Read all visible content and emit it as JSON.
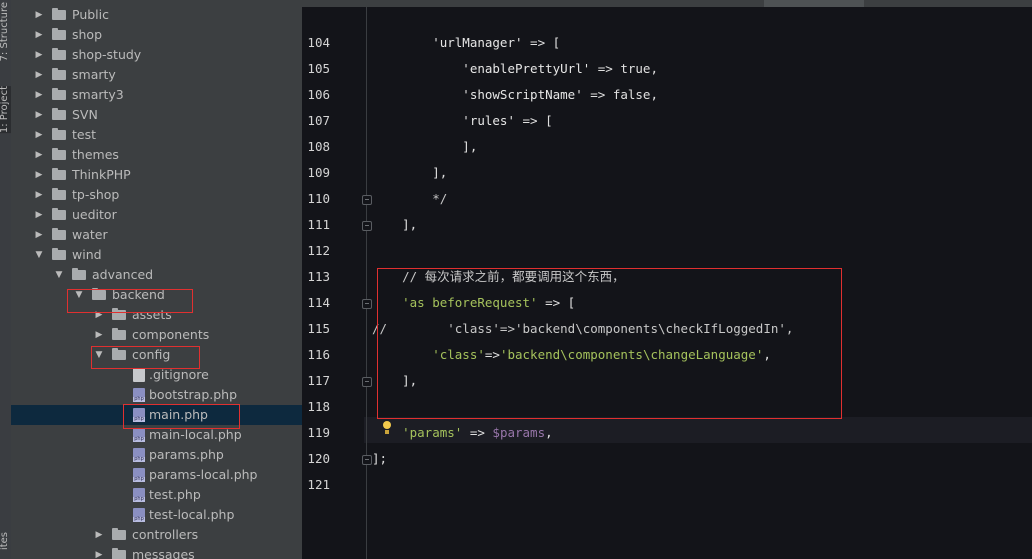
{
  "side_tabs": {
    "structure": "7: Structure",
    "project": "1: Project",
    "bottom": "ites"
  },
  "tree": [
    {
      "label": "Public",
      "indent": 0,
      "kind": "folder",
      "expanded": false
    },
    {
      "label": "shop",
      "indent": 0,
      "kind": "folder",
      "expanded": false
    },
    {
      "label": "shop-study",
      "indent": 0,
      "kind": "folder",
      "expanded": false
    },
    {
      "label": "smarty",
      "indent": 0,
      "kind": "folder",
      "expanded": false
    },
    {
      "label": "smarty3",
      "indent": 0,
      "kind": "folder",
      "expanded": false
    },
    {
      "label": "SVN",
      "indent": 0,
      "kind": "folder",
      "expanded": false
    },
    {
      "label": "test",
      "indent": 0,
      "kind": "folder",
      "expanded": false
    },
    {
      "label": "themes",
      "indent": 0,
      "kind": "folder",
      "expanded": false
    },
    {
      "label": "ThinkPHP",
      "indent": 0,
      "kind": "folder",
      "expanded": false
    },
    {
      "label": "tp-shop",
      "indent": 0,
      "kind": "folder",
      "expanded": false
    },
    {
      "label": "ueditor",
      "indent": 0,
      "kind": "folder",
      "expanded": false
    },
    {
      "label": "water",
      "indent": 0,
      "kind": "folder",
      "expanded": false
    },
    {
      "label": "wind",
      "indent": 0,
      "kind": "folder",
      "expanded": true
    },
    {
      "label": "advanced",
      "indent": 1,
      "kind": "folder",
      "expanded": true
    },
    {
      "label": "backend",
      "indent": 2,
      "kind": "folder",
      "expanded": true
    },
    {
      "label": "assets",
      "indent": 3,
      "kind": "folder",
      "expanded": false
    },
    {
      "label": "components",
      "indent": 3,
      "kind": "folder",
      "expanded": false
    },
    {
      "label": "config",
      "indent": 3,
      "kind": "folder",
      "expanded": true
    },
    {
      "label": ".gitignore",
      "indent": 4,
      "kind": "git"
    },
    {
      "label": "bootstrap.php",
      "indent": 4,
      "kind": "php"
    },
    {
      "label": "main.php",
      "indent": 4,
      "kind": "php",
      "selected": true
    },
    {
      "label": "main-local.php",
      "indent": 4,
      "kind": "php"
    },
    {
      "label": "params.php",
      "indent": 4,
      "kind": "php"
    },
    {
      "label": "params-local.php",
      "indent": 4,
      "kind": "php"
    },
    {
      "label": "test.php",
      "indent": 4,
      "kind": "php"
    },
    {
      "label": "test-local.php",
      "indent": 4,
      "kind": "php"
    },
    {
      "label": "controllers",
      "indent": 3,
      "kind": "folder",
      "expanded": false
    },
    {
      "label": "messages",
      "indent": 3,
      "kind": "folder",
      "expanded": false
    }
  ],
  "code_lines": [
    {
      "n": "104",
      "segs": [
        [
          "str",
          "        'urlManager'"
        ],
        [
          "op",
          " => ["
        ]
      ]
    },
    {
      "n": "105",
      "segs": [
        [
          "str",
          "            'enablePrettyUrl'"
        ],
        [
          "op",
          " => true,"
        ]
      ]
    },
    {
      "n": "106",
      "segs": [
        [
          "str",
          "            'showScriptName'"
        ],
        [
          "op",
          " => false,"
        ]
      ]
    },
    {
      "n": "107",
      "segs": [
        [
          "str",
          "            'rules'"
        ],
        [
          "op",
          " => ["
        ]
      ]
    },
    {
      "n": "108",
      "segs": [
        [
          "op",
          "            ],"
        ]
      ]
    },
    {
      "n": "109",
      "segs": [
        [
          "op",
          "        ],"
        ]
      ]
    },
    {
      "n": "110",
      "segs": [
        [
          "cmt",
          "        */"
        ]
      ]
    },
    {
      "n": "111",
      "segs": [
        [
          "op",
          "    ],"
        ]
      ]
    },
    {
      "n": "112",
      "segs": []
    },
    {
      "n": "113",
      "segs": [
        [
          "cmt",
          "    // 每次请求之前，都要调用这个东西，"
        ]
      ]
    },
    {
      "n": "114",
      "segs": [
        [
          "grn",
          "    'as beforeRequest'"
        ],
        [
          "op",
          " => ["
        ]
      ]
    },
    {
      "n": "115",
      "segs": [
        [
          "cmt",
          "//        'class'=>'backend\\components\\checkIfLoggedIn',"
        ]
      ]
    },
    {
      "n": "116",
      "segs": [
        [
          "grn",
          "        'class'"
        ],
        [
          "op",
          "=>"
        ],
        [
          "grn",
          "'backend\\components\\changeLanguage'"
        ],
        [
          "op",
          ","
        ]
      ]
    },
    {
      "n": "117",
      "segs": [
        [
          "op",
          "    ],"
        ]
      ]
    },
    {
      "n": "118",
      "segs": []
    },
    {
      "n": "119",
      "segs": [
        [
          "grn",
          "    'params'"
        ],
        [
          "op",
          " => "
        ],
        [
          "var",
          "$params"
        ],
        [
          "op",
          ","
        ]
      ]
    },
    {
      "n": "120",
      "segs": [
        [
          "op",
          "];"
        ]
      ]
    },
    {
      "n": "121",
      "segs": []
    }
  ],
  "colors": {
    "tree_bg": "#3c3f41",
    "editor_bg": "#131419",
    "selection": "#0d293e",
    "annotation": "#e03030",
    "string_green": "#a5c25c"
  }
}
